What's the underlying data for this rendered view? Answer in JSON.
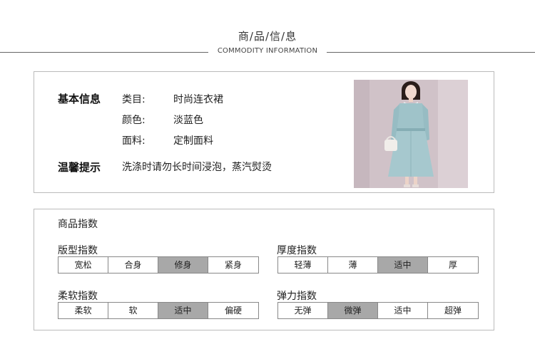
{
  "header": {
    "title_cn": "商/品/信/息",
    "title_en": "COMMODITY INFORMATION"
  },
  "basic_info": {
    "label": "基本信息",
    "rows": [
      {
        "key": "类目:",
        "value": "时尚连衣裙"
      },
      {
        "key": "颜色:",
        "value": "淡蓝色"
      },
      {
        "key": "面料:",
        "value": "定制面料"
      }
    ]
  },
  "tip": {
    "label": "温馨提示",
    "text": "洗涤时请勿长时间浸泡，蒸汽熨烫"
  },
  "index": {
    "title": "商品指数",
    "groups": [
      {
        "title": "版型指数",
        "options": [
          "宽松",
          "合身",
          "修身",
          "紧身"
        ],
        "selected": 2
      },
      {
        "title": "厚度指数",
        "options": [
          "轻薄",
          "薄",
          "适中",
          "厚"
        ],
        "selected": 2
      },
      {
        "title": "柔软指数",
        "options": [
          "柔软",
          "软",
          "适中",
          "偏硬"
        ],
        "selected": 2
      },
      {
        "title": "弹力指数",
        "options": [
          "无弹",
          "微弹",
          "适中",
          "超弹"
        ],
        "selected": 1
      }
    ]
  },
  "colors": {
    "selected_cell": "#a8a8a8",
    "dress": "#9fc3c9",
    "photo_bg": "#cfc1c7"
  }
}
